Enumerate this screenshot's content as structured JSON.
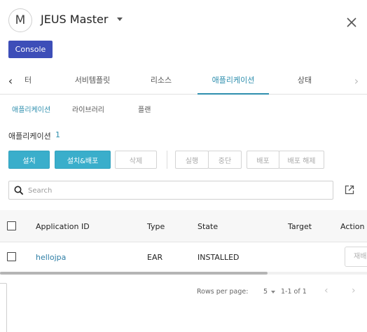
{
  "header": {
    "avatar_letter": "M",
    "title": "JEUS Master"
  },
  "toolbar": {
    "console_label": "Console"
  },
  "tabs": [
    {
      "label": "터"
    },
    {
      "label": "서비템플릿"
    },
    {
      "label": "리소스"
    },
    {
      "label": "애플리케이션",
      "active": true
    },
    {
      "label": "상태"
    }
  ],
  "subtabs": [
    {
      "label": "애플리케이션",
      "active": true
    },
    {
      "label": "라이브러리"
    },
    {
      "label": "플랜"
    }
  ],
  "section": {
    "title": "애플리케이션",
    "count": "1"
  },
  "actions": {
    "install": "설치",
    "install_deploy": "설치&배포",
    "delete": "삭제",
    "run": "실행",
    "stop": "중단",
    "deploy": "배포",
    "undeploy": "배포 해제"
  },
  "search": {
    "placeholder": "Search"
  },
  "table": {
    "columns": [
      "Application ID",
      "Type",
      "State",
      "Target",
      "Action"
    ],
    "rows": [
      {
        "id": "hellojpa",
        "type": "EAR",
        "state": "INSTALLED",
        "target": "",
        "action": "재배"
      }
    ]
  },
  "pagination": {
    "rows_per_page_label": "Rows per page:",
    "rows_per_page": "5",
    "range": "1-1 of 1"
  },
  "colors": {
    "accent": "#2f8fae",
    "primary_button": "#3aaecb",
    "console_button": "#3d4eb8"
  }
}
